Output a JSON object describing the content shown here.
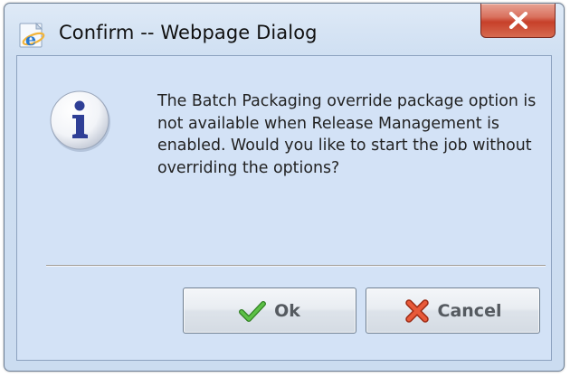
{
  "window": {
    "title": "Confirm -- Webpage Dialog",
    "app_icon": "internet-explorer-icon",
    "close_icon": "close-icon"
  },
  "dialog": {
    "message_icon": "info-icon",
    "message": "The Batch Packaging override package option is not available when Release Management is enabled. Would you like to start the job without overriding the options?"
  },
  "buttons": {
    "ok": {
      "label": "Ok",
      "icon": "checkmark-icon",
      "color": "#3a9a2c"
    },
    "cancel": {
      "label": "Cancel",
      "icon": "x-icon",
      "color": "#d9452a"
    }
  }
}
